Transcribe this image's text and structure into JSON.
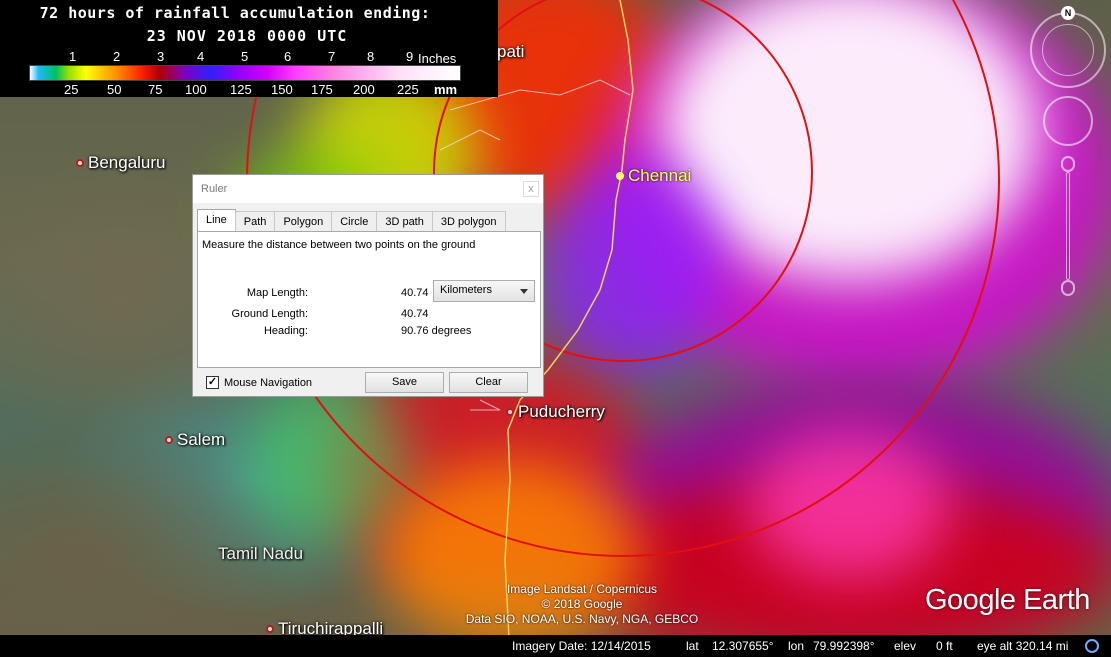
{
  "legend": {
    "title_line1": "72 hours of rainfall accumulation ending:",
    "title_line2": "23 NOV 2018 0000 UTC",
    "inch_ticks": [
      "1",
      "2",
      "3",
      "4",
      "5",
      "6",
      "7",
      "8",
      "9"
    ],
    "inch_unit": "Inches",
    "mm_ticks": [
      "25",
      "50",
      "75",
      "100",
      "125",
      "150",
      "175",
      "200",
      "225"
    ],
    "mm_unit": "mm"
  },
  "map": {
    "labels": {
      "tirupati_partial": "pati",
      "bengaluru": "Bengaluru",
      "chennai": "Chennai",
      "salem": "Salem",
      "puducherry": "Puducherry",
      "tamil_nadu": "Tamil Nadu",
      "tiruchirappalli": "Tiruchirappalli"
    },
    "circle_color": "#e01010",
    "coast_color": "#f0d060",
    "compass_label": "N"
  },
  "ruler": {
    "title": "Ruler",
    "close_label": "x",
    "tabs": [
      {
        "label": "Line",
        "active": true
      },
      {
        "label": "Path",
        "active": false
      },
      {
        "label": "Polygon",
        "active": false
      },
      {
        "label": "Circle",
        "active": false
      },
      {
        "label": "3D path",
        "active": false
      },
      {
        "label": "3D polygon",
        "active": false
      }
    ],
    "description": "Measure the distance between two points on the ground",
    "map_length_label": "Map Length:",
    "map_length_value": "40.74",
    "units_selected": "Kilometers",
    "ground_length_label": "Ground Length:",
    "ground_length_value": "40.74",
    "heading_label": "Heading:",
    "heading_value": "90.76 degrees",
    "mouse_navigation_label": "Mouse Navigation",
    "mouse_navigation_checked": "✓",
    "save_label": "Save",
    "clear_label": "Clear"
  },
  "credits": {
    "line1": "Image Landsat / Copernicus",
    "line2": "© 2018 Google",
    "line3": "Data SIO, NOAA, U.S. Navy, NGA, GEBCO",
    "logo": "Google Earth"
  },
  "status": {
    "imagery_date": "Imagery Date: 12/14/2015",
    "lat_label": "lat",
    "lat_value": "12.307655°",
    "lon_label": "lon",
    "lon_value": "79.992398°",
    "elev_label": "elev",
    "elev_value": "0 ft",
    "eye_alt": "eye alt 320.14 mi"
  }
}
